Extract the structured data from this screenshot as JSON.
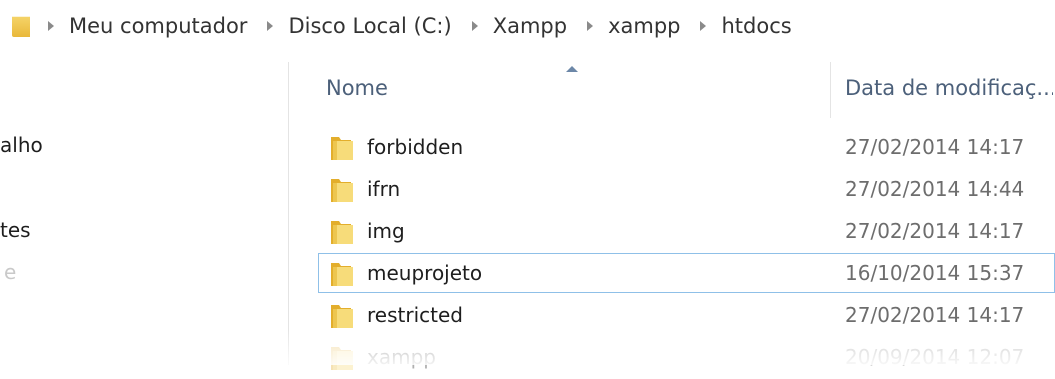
{
  "breadcrumb": {
    "items": [
      "Meu computador",
      "Disco Local (C:)",
      "Xampp",
      "xampp",
      "htdocs"
    ]
  },
  "nav": {
    "items": [
      "alho",
      "tes",
      "e"
    ]
  },
  "columns": {
    "name": "Nome",
    "date": "Data de modificaç..."
  },
  "files": [
    {
      "name": "forbidden",
      "date": "27/02/2014 14:17"
    },
    {
      "name": "ifrn",
      "date": "27/02/2014 14:44"
    },
    {
      "name": "img",
      "date": "27/02/2014 14:17"
    },
    {
      "name": "meuprojeto",
      "date": "16/10/2014 15:37"
    },
    {
      "name": "restricted",
      "date": "27/02/2014 14:17"
    },
    {
      "name": "xampp",
      "date": "20/09/2014 12:07"
    }
  ],
  "selected_file": "meuprojeto",
  "colors": {
    "folder_light": "#f7dc7a",
    "folder_dark": "#e3ae2c",
    "selection_border": "#8fc0e8",
    "header_text": "#4c607a"
  }
}
